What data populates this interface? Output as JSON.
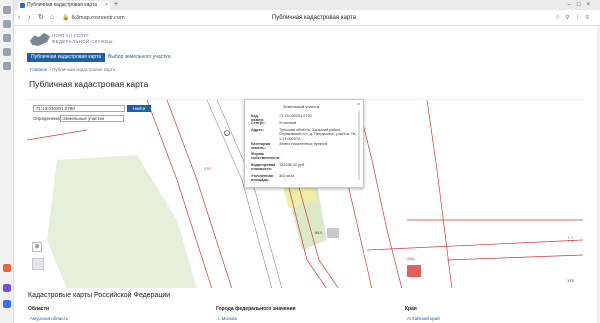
{
  "browser": {
    "tab_title": "Публичная кадастровая карта",
    "url": "lk3map.rosreestr.com",
    "page_title": "Публичная кадастровая карта"
  },
  "portal": {
    "logo_text_1": "ПОРТАЛ УСЛУГ",
    "logo_text_2": "ФЕДЕРАЛЬНОЙ СЛУЖБЫ",
    "nav_button": "Публичная кадастровая карта",
    "nav_link": "Выбор земельного участка",
    "breadcrumb_home": "Главная",
    "breadcrumb_current": "Публичная кадастровая карта",
    "heading": "Публичная кадастровая карта"
  },
  "map": {
    "search_value": "71:13:030201:2790",
    "search_button": "Найти",
    "define_label": "Определение:",
    "define_value": "Земельные участки",
    "labels": [
      "270",
      "644",
      "268",
      "175"
    ]
  },
  "popup": {
    "title": "Земельный участок",
    "rows": [
      {
        "label": "Кад. номер:",
        "value": "71:13:030201:2790"
      },
      {
        "label": "Статус:",
        "value": "Учтенный"
      },
      {
        "label": "Адрес:",
        "value": "Тульская область, Заокский район, Страховский с/о, д. Петрушино, участок, № 1:13:000070…"
      },
      {
        "label": "Категория земель:",
        "value": "Земли населенных пунктов"
      },
      {
        "label": "Форма собственности:",
        "value": ""
      },
      {
        "label": "Кадастровая стоимость:",
        "value": "152038.32 руб."
      },
      {
        "label": "Уточненная площадь:",
        "value": "300 кв.м"
      }
    ]
  },
  "regions": {
    "heading": "Кадастровые карты Российской Федерации",
    "col1_title": "Области",
    "col1_item": "Амурская область",
    "col2_title": "Города федерального значения",
    "col2_item": "г. Москва",
    "col3_title": "Края",
    "col3_item": "Алтайский край"
  }
}
